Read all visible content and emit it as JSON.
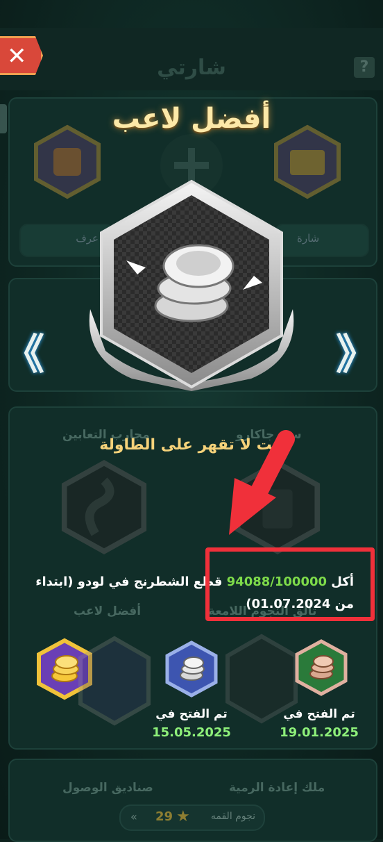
{
  "header": {
    "title": "شارتي",
    "help_label": "?",
    "close_label": "✕"
  },
  "popup": {
    "title": "أفضل لاعب",
    "subtitle": "أنت لا تقهر على الطاولة",
    "description_prefix": "أكل ",
    "progress": "94088/100000",
    "description_suffix": " قطع الشطرنج في لودو (ابتداء من 01.07.2024)",
    "prev_arrow": "《",
    "next_arrow": "》"
  },
  "tiers": [
    {
      "label": "تم الفتح في",
      "date": "19.01.2025"
    },
    {
      "label": "تم الفتح في",
      "date": "15.05.2025"
    }
  ],
  "background": {
    "labels_row1": [
      "مجارب التعابين",
      "سيد جاكارو"
    ],
    "label_row2": "أفضل لاعب",
    "label_row2b": "تألق النجوم اللامعة",
    "labels_row3": [
      "صناديق الوصول",
      "ملك إعادة الرمية"
    ],
    "stars_count": "29",
    "stars_label": "نجوم القمه",
    "stars_arrows": "«",
    "badge_buttons": [
      "شارة",
      "عرف"
    ]
  },
  "colors": {
    "accent_red": "#f0303a",
    "progress_green": "#7edb4a",
    "date_green": "#8ef07a",
    "title_gold": "#fde9a8"
  },
  "icons": [
    "close-icon",
    "help-icon",
    "left-chevron-icon",
    "right-chevron-icon",
    "silver-badge-icon",
    "gold-badge-icon",
    "blue-badge-icon",
    "bronze-badge-icon",
    "star-icon"
  ]
}
